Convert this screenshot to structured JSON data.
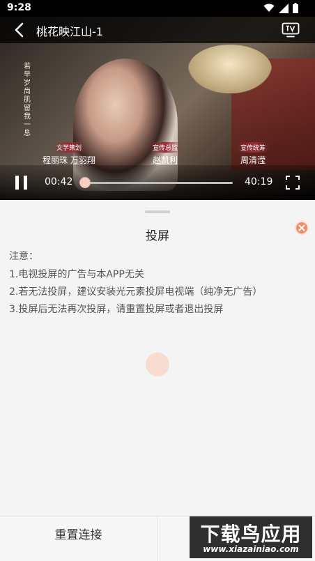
{
  "status_bar": {
    "time": "9:28"
  },
  "player": {
    "title": "桃花映江山-1",
    "current_time": "00:42",
    "total_time": "40:19",
    "progress": 0.017,
    "overlay": {
      "poem": "若早岁尚肌留我一息",
      "credits": [
        {
          "role": "文学策划",
          "name": "程丽珠 万羽翔"
        },
        {
          "role": "宣传总监",
          "name": "赵凯利"
        },
        {
          "role": "宣传统筹",
          "name": "周清滢"
        }
      ]
    }
  },
  "sheet": {
    "title": "投屏",
    "notice_heading": "注意：",
    "notes": [
      "1.电视投屏的广告与本APP无关",
      "2.若无法投屏，建议安装光元素投屏电视端（纯净无广告）",
      "3.投屏后无法再次投屏，请重置投屏或者退出投屏"
    ]
  },
  "bottom": {
    "reset_label": "重置连接"
  },
  "watermark": {
    "text": "下载鸟应用",
    "url": "www.xiazainiao.com"
  },
  "colors": {
    "accent": "#f08c6a",
    "loader": "#f7dccf"
  }
}
